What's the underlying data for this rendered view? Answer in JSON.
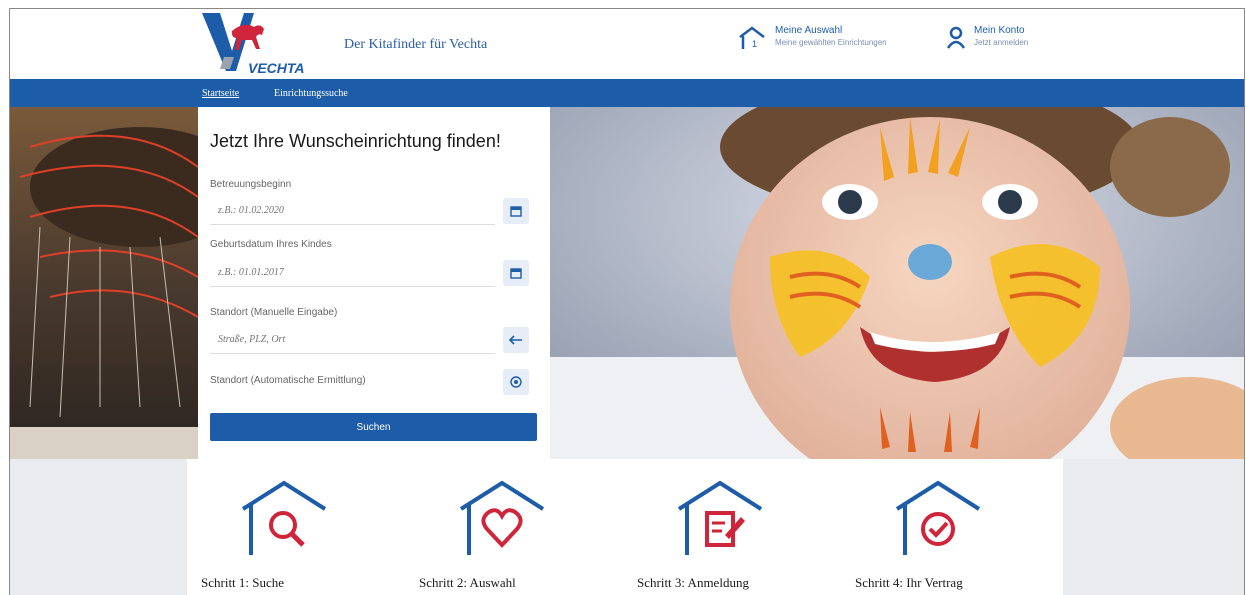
{
  "header": {
    "logo_text": "VECHTA",
    "tagline": "Der Kitafinder für Vechta",
    "selection": {
      "title": "Meine Auswahl",
      "subtitle": "Meine gewählten Einrichtungen",
      "count": "1"
    },
    "account": {
      "title": "Mein Konto",
      "subtitle": "Jetzt anmelden"
    }
  },
  "nav": {
    "items": [
      "Startseite",
      "Einrichtungssuche"
    ]
  },
  "form": {
    "title": "Jetzt Ihre Wunscheinrichtung finden!",
    "start_label": "Betreuungsbeginn",
    "start_placeholder": "z.B.: 01.02.2020",
    "birth_label": "Geburtsdatum Ihres Kindes",
    "birth_placeholder": "z.B.: 01.01.2017",
    "location_label": "Standort (Manuelle Eingabe)",
    "location_placeholder": "Straße, PLZ, Ort",
    "auto_location_label": "Standort (Automatische Ermittlung)",
    "search_button": "Suchen"
  },
  "steps": [
    {
      "label": "Schritt 1: Suche",
      "icon": "search-icon"
    },
    {
      "label": "Schritt 2: Auswahl",
      "icon": "heart-icon"
    },
    {
      "label": "Schritt 3: Anmeldung",
      "icon": "document-edit-icon"
    },
    {
      "label": "Schritt 4: Ihr Vertrag",
      "icon": "check-icon"
    }
  ],
  "colors": {
    "brand_blue": "#1d5ca8",
    "accent_red": "#d0243a"
  }
}
